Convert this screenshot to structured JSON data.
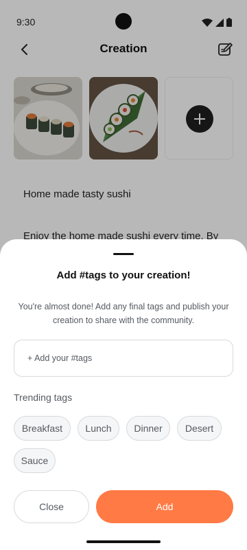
{
  "status_bar": {
    "time": "9:30"
  },
  "header": {
    "title": "Creation"
  },
  "recipe": {
    "title": "Home made tasty sushi",
    "description": "Enjoy the home made sushi every time. By"
  },
  "sheet": {
    "title": "Add #tags to your creation!",
    "description": "You're almost done! Add any final tags and publish your creation to share with the community.",
    "tag_input_placeholder": "+ Add your #tags",
    "trending_label": "Trending tags",
    "tags": [
      "Breakfast",
      "Lunch",
      "Dinner",
      "Desert",
      "Sauce"
    ],
    "close_label": "Close",
    "add_label": "Add"
  },
  "colors": {
    "accent": "#ff7a45",
    "chip_bg": "#f5f6f7",
    "chip_border": "#d6d9dc"
  }
}
